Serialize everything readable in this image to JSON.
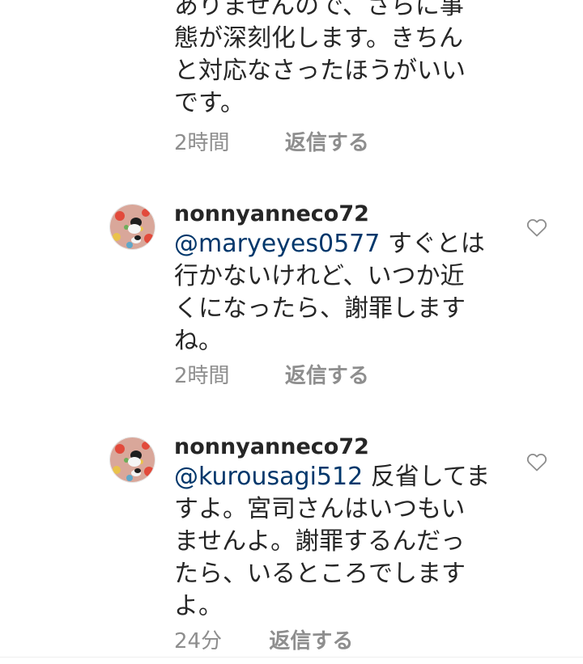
{
  "comments": [
    {
      "lines": [
        "ありませんので、さらに事",
        "態が深刻化します。きちん",
        "と対応なさったほうがいい",
        "です。"
      ],
      "time": "2時間",
      "reply": "返信する"
    },
    {
      "username": "nonnyanneco72",
      "mention": "@maryeyes0577",
      "lines": [
        " すぐとは",
        "行かないけれど、いつか近",
        "くになったら、謝罪します",
        "ね。"
      ],
      "time": "2時間",
      "reply": "返信する",
      "like_icon": "heart-outline-icon"
    },
    {
      "username": "nonnyanneco72",
      "mention": "@kurousagi512",
      "lines": [
        " 反省してま",
        "すよ。宮司さんはいつもい",
        "ませんよ。謝罪するんだっ",
        "たら、いるところでします",
        "よ。"
      ],
      "time": "24分",
      "reply": "返信する",
      "like_icon": "heart-outline-icon"
    }
  ],
  "colors": {
    "text": "#262626",
    "mention": "#00376b",
    "meta": "#8e8e8e",
    "avatar_bg": "#d9a79a"
  }
}
